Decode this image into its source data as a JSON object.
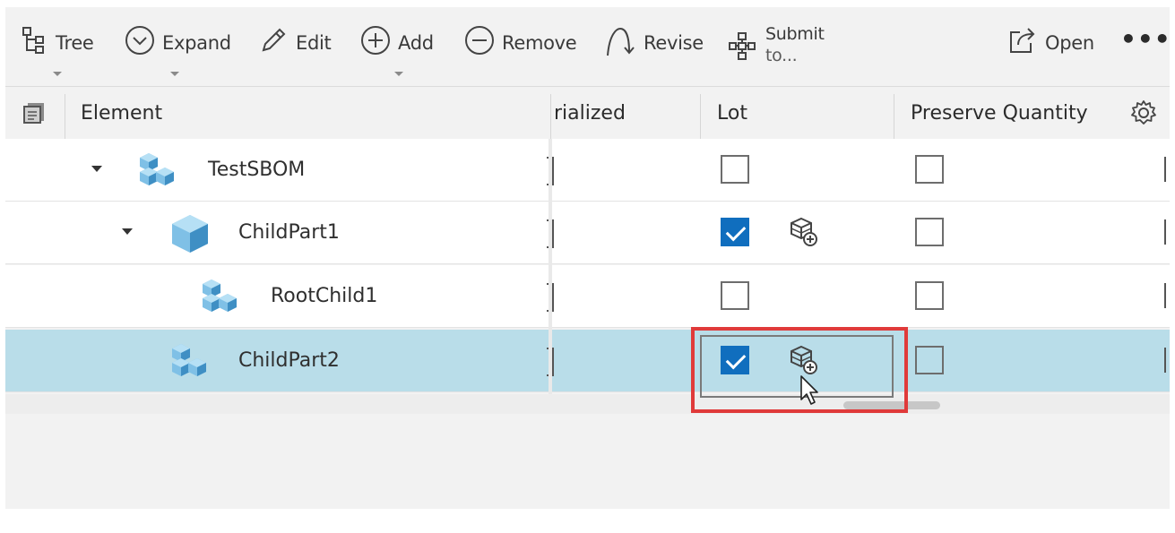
{
  "toolbar": {
    "tree_label": "Tree",
    "expand_label": "Expand",
    "edit_label": "Edit",
    "add_label": "Add",
    "remove_label": "Remove",
    "revise_label": "Revise",
    "submit_label_line1": "Submit",
    "submit_label_line2": "to...",
    "open_label": "Open",
    "more_label": "•••"
  },
  "header": {
    "element": "Element",
    "serialized": "rialized",
    "lot": "Lot",
    "preserve_quantity": "Preserve Quantity"
  },
  "rows": [
    {
      "name": "TestSBOM",
      "lot_checked": false,
      "preserve_checked": false,
      "expanded": true,
      "selected": false
    },
    {
      "name": "ChildPart1",
      "lot_checked": true,
      "preserve_checked": false,
      "expanded": true,
      "selected": false
    },
    {
      "name": "RootChild1",
      "lot_checked": false,
      "preserve_checked": false,
      "expanded": false,
      "selected": false
    },
    {
      "name": "ChildPart2",
      "lot_checked": true,
      "preserve_checked": false,
      "expanded": false,
      "selected": true
    }
  ],
  "colors": {
    "selected_row": "#b9dde9",
    "checkbox_checked": "#106ebe",
    "highlight_box": "#e03a3a",
    "part_icon": "#5ea8d6"
  },
  "icons": {
    "tree": "tree-structure-icon",
    "expand": "expand-circle-icon",
    "edit": "pencil-icon",
    "add": "plus-circle-icon",
    "remove": "minus-circle-icon",
    "revise": "revise-arc-icon",
    "submit": "workflow-icon",
    "open": "open-external-icon",
    "settings": "gear-icon",
    "lot": "lot-cube-add-icon"
  }
}
